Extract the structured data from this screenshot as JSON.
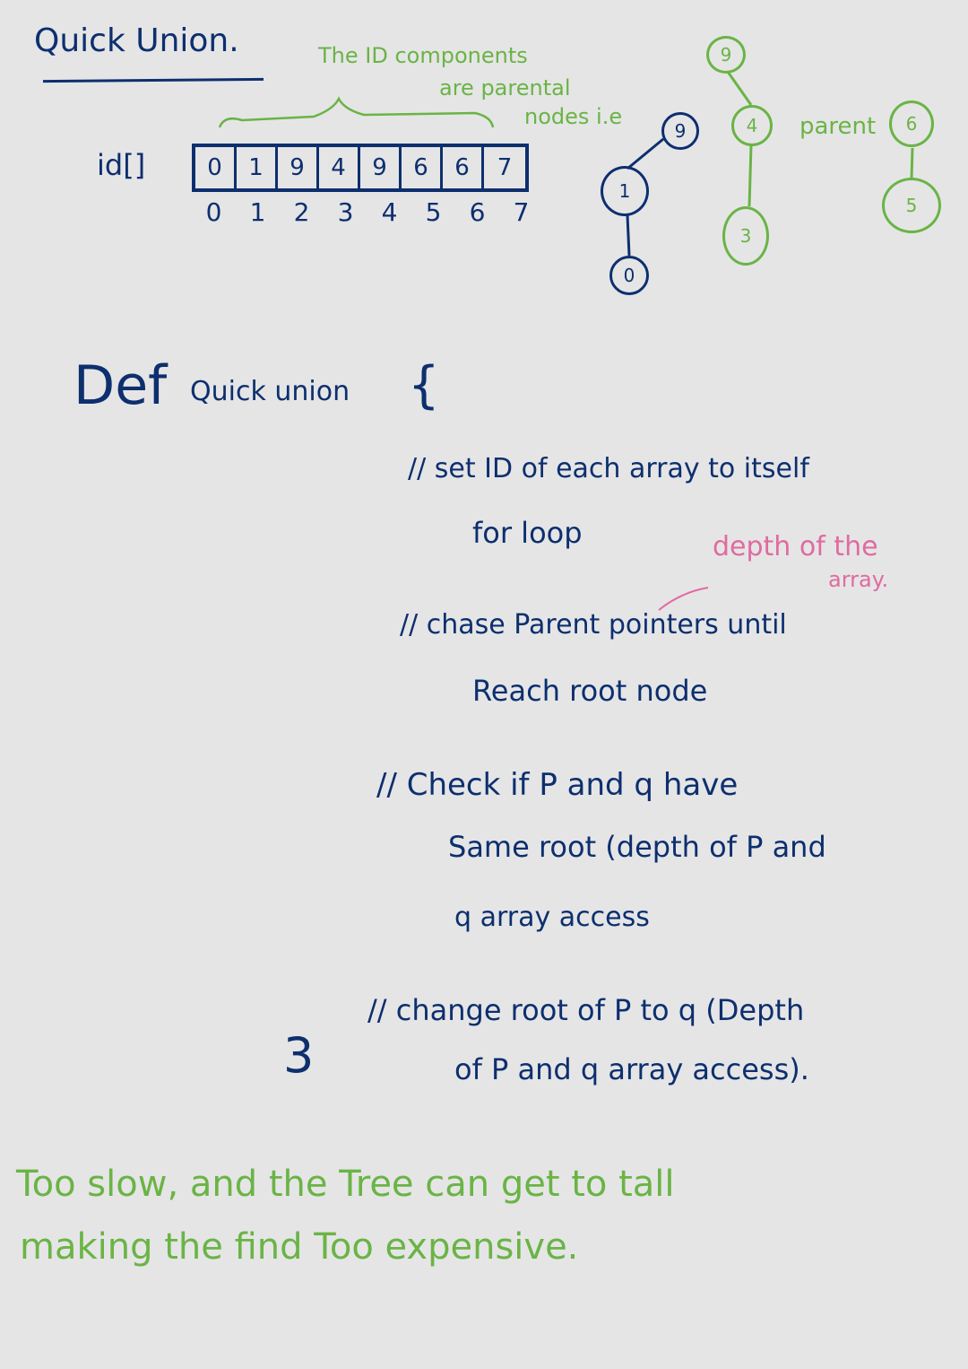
{
  "header": {
    "title": "Quick Union."
  },
  "note_top": {
    "line1": "The ID components",
    "line2": "are parental",
    "line3": "nodes i.e"
  },
  "id_array": {
    "label": "id[]",
    "values": [
      "0",
      "1",
      "9",
      "4",
      "9",
      "6",
      "6",
      "7"
    ],
    "indices": [
      "0",
      "1",
      "2",
      "3",
      "4",
      "5",
      "6",
      "7"
    ]
  },
  "trees": {
    "navy_nodes": [
      "9",
      "1",
      "0"
    ],
    "green_nodes": [
      "9",
      "4",
      "3",
      "6",
      "5"
    ],
    "parent_label": "parent"
  },
  "code": {
    "def_line": "Def",
    "def_name": "Quick union",
    "open_brace": "{",
    "c1_line1": "// set ID of each array to itself",
    "c1_line2": "for loop",
    "c2_line1": "// chase Parent pointers until",
    "c2_line2": "Reach root node",
    "c3_line1": "// Check if P and q have",
    "c3_line2": "Same root (depth of P and",
    "c3_line3": "q array access",
    "c4_line1": "// change root of P to q (Depth",
    "c4_line2": "of P and q array access).",
    "close_brace": "3",
    "annotation_line1": "depth of the",
    "annotation_line2": "array."
  },
  "footer": {
    "line1": "Too slow, and the Tree can get to tall",
    "line2": "making the find Too expensive."
  }
}
